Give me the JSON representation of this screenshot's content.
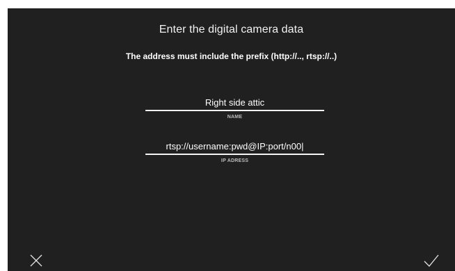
{
  "header": {
    "title": "Enter the digital camera data",
    "subtitle": "The address must include the prefix (http://.., rtsp://..)"
  },
  "form": {
    "name_field": {
      "value": "Right side attic",
      "label": "NAME"
    },
    "ip_field": {
      "value": "rtsp://username:pwd@IP:port/n00|",
      "label": "IP ADRESS"
    }
  },
  "actions": {
    "cancel_icon": "close-icon",
    "confirm_icon": "checkmark-icon"
  },
  "colors": {
    "background": "#202020",
    "text": "#ffffff",
    "label": "#bdbdbd",
    "underline": "#f5f5f5"
  }
}
